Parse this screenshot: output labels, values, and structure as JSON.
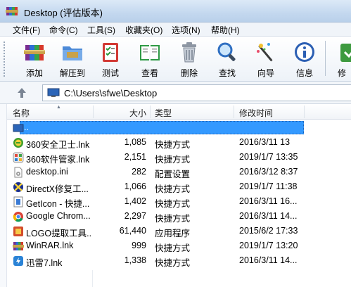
{
  "window": {
    "title": "Desktop (评估版本)"
  },
  "menu": {
    "items": [
      {
        "label": "文件(F)"
      },
      {
        "label": "命令(C)"
      },
      {
        "label": "工具(S)"
      },
      {
        "label": "收藏夹(O)"
      },
      {
        "label": "选项(N)"
      },
      {
        "label": "帮助(H)"
      }
    ]
  },
  "toolbar": {
    "buttons": [
      {
        "label": "添加",
        "icon": "add-archive-icon"
      },
      {
        "label": "解压到",
        "icon": "extract-folder-icon"
      },
      {
        "label": "测试",
        "icon": "test-checklist-icon"
      },
      {
        "label": "查看",
        "icon": "view-book-icon"
      },
      {
        "label": "删除",
        "icon": "trash-icon"
      },
      {
        "label": "查找",
        "icon": "magnifier-icon"
      },
      {
        "label": "向导",
        "icon": "wizard-wand-icon"
      },
      {
        "label": "信息",
        "icon": "info-icon"
      },
      {
        "label": "修",
        "icon": "repair-icon"
      }
    ]
  },
  "address": {
    "path": "C:\\Users\\sfwe\\Desktop"
  },
  "columns": {
    "name": "名称",
    "size": "大小",
    "type": "类型",
    "modified": "修改时间"
  },
  "files": [
    {
      "name": "..",
      "size": "",
      "type": "",
      "modified": "",
      "icon": "folder-up-icon"
    },
    {
      "name": "360安全卫士.lnk",
      "size": "1,085",
      "type": "快捷方式",
      "modified": "2016/3/11 13",
      "icon": "360-safe-icon"
    },
    {
      "name": "360软件管家.lnk",
      "size": "2,151",
      "type": "快捷方式",
      "modified": "2019/1/7 13:35",
      "icon": "360-software-icon"
    },
    {
      "name": "desktop.ini",
      "size": "282",
      "type": "配置设置",
      "modified": "2016/3/12 8:37",
      "icon": "ini-file-icon"
    },
    {
      "name": "DirectX修复工...",
      "size": "1,066",
      "type": "快捷方式",
      "modified": "2019/1/7 11:38",
      "icon": "directx-icon"
    },
    {
      "name": "GetIcon - 快捷...",
      "size": "1,402",
      "type": "快捷方式",
      "modified": "2016/3/11 16...",
      "icon": "geticon-icon"
    },
    {
      "name": "Google Chrom...",
      "size": "2,297",
      "type": "快捷方式",
      "modified": "2016/3/11 14...",
      "icon": "chrome-icon"
    },
    {
      "name": "LOGO提取工具...",
      "size": "61,440",
      "type": "应用程序",
      "modified": "2015/6/2 17:33",
      "icon": "logo-tool-icon"
    },
    {
      "name": "WinRAR.lnk",
      "size": "999",
      "type": "快捷方式",
      "modified": "2019/1/7 13:20",
      "icon": "winrar-icon"
    },
    {
      "name": "迅雷7.lnk",
      "size": "1,338",
      "type": "快捷方式",
      "modified": "2016/3/11 14...",
      "icon": "thunder-icon"
    }
  ]
}
